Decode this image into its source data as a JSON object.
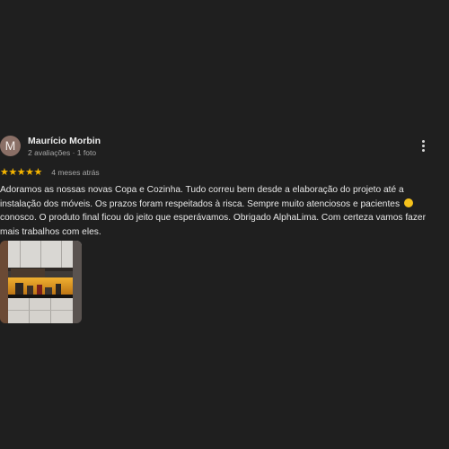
{
  "review": {
    "avatar_letter": "M",
    "author": "Maurício Morbin",
    "meta": "2 avaliações · 1 foto",
    "stars": "★★★★★",
    "rating": 5,
    "date": "4 meses atrás",
    "text": "Adoramos as nossas novas Copa e Cozinha. Tudo correu bem desde a elaboração do projeto até a instalação dos móveis. Os prazos foram respeitados à risca. Sempre muito atenciosos e pacientes",
    "text2": "conosco. O produto final ficou do jeito que esperávamos. Obrigado AlphaLima. Com certeza vamos fazer mais trabalhos com eles."
  },
  "colors": {
    "background": "#1f1f1f",
    "star": "#f4b400",
    "avatar": "#8a6f66"
  },
  "icons": {
    "more": "more-vert-icon",
    "emoji": "smiling-face-emoji"
  }
}
